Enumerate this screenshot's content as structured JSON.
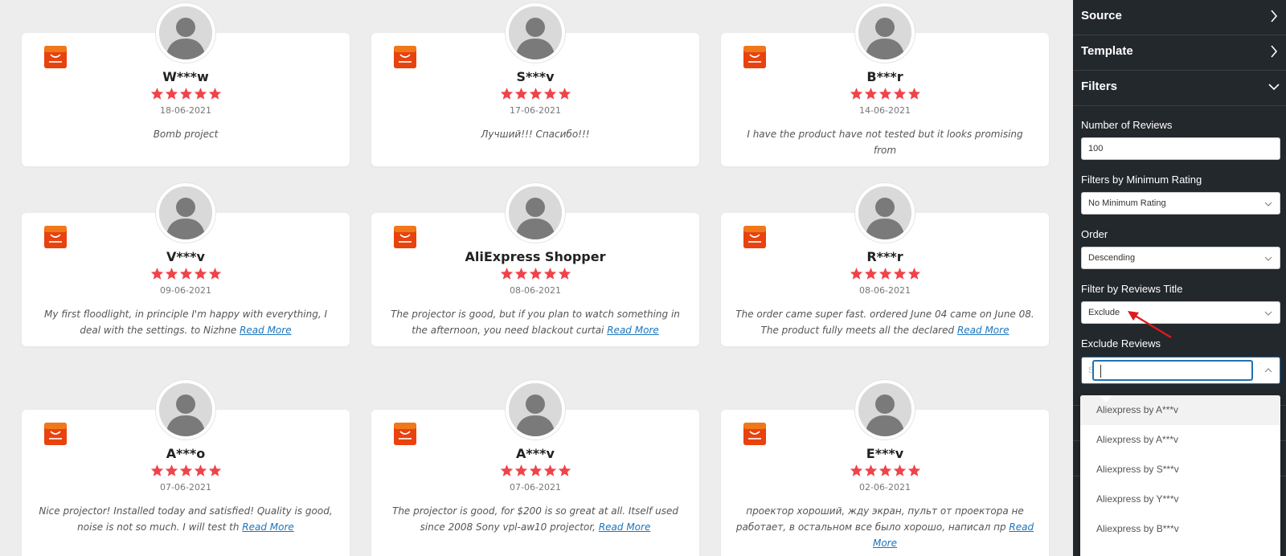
{
  "reviews": [
    {
      "name": "W***w",
      "rating": 5,
      "date": "18-06-2021",
      "text": "Bomb project",
      "read_more": ""
    },
    {
      "name": "S***v",
      "rating": 5,
      "date": "17-06-2021",
      "text": "Лучший!!! Спасибо!!!",
      "read_more": ""
    },
    {
      "name": "B***r",
      "rating": 5,
      "date": "14-06-2021",
      "text": "I have the product have not tested but it looks promising from",
      "read_more": ""
    },
    {
      "name": "V***v",
      "rating": 5,
      "date": "09-06-2021",
      "text": "My first floodlight, in principle I'm happy with everything, I deal with the settings. to Nizhne",
      "read_more": "Read More"
    },
    {
      "name": "AliExpress Shopper",
      "rating": 5,
      "date": "08-06-2021",
      "text": "The projector is good, but if you plan to watch something in the afternoon, you need blackout curtai",
      "read_more": "Read More"
    },
    {
      "name": "R***r",
      "rating": 5,
      "date": "08-06-2021",
      "text": "The order came super fast. ordered June 04 came on June 08. The product fully meets all the declared",
      "read_more": "Read More"
    },
    {
      "name": "A***o",
      "rating": 5,
      "date": "07-06-2021",
      "text": "Nice projector! Installed today and satisfied! Quality is good, noise is not so much. I will test th",
      "read_more": "Read More"
    },
    {
      "name": "A***v",
      "rating": 5,
      "date": "07-06-2021",
      "text": "The projector is good, for $200 is so great at all. Itself used since 2008 Sony vpl-aw10 projector, ",
      "read_more": "Read More"
    },
    {
      "name": "E***v",
      "rating": 5,
      "date": "02-06-2021",
      "text": "проектор хороший, жду экран, пульт от проектора не работает, в остальном все было хорошо, написал пр",
      "read_more": "Read More"
    }
  ],
  "panel": {
    "sections": [
      "Source",
      "Template",
      "Filters"
    ],
    "number_of_reviews": {
      "label": "Number of Reviews",
      "value": "100"
    },
    "min_rating": {
      "label": "Filters by Minimum Rating",
      "value": "No Minimum Rating"
    },
    "order": {
      "label": "Order",
      "value": "Descending"
    },
    "filter_title": {
      "label": "Filter by Reviews Title",
      "value": "Exclude"
    },
    "exclude_reviews": {
      "label": "Exclude Reviews",
      "value": "",
      "prefix": "S"
    },
    "options": [
      "Aliexpress by A***v",
      "Aliexpress by A***v",
      "Aliexpress by S***v",
      "Aliexpress by Y***v",
      "Aliexpress by B***v"
    ]
  },
  "colors": {
    "star": "#f0434a",
    "panel_bg": "#23282d",
    "link": "#1b75bc",
    "arrow": "#e0191e",
    "focus": "#2271b1",
    "aliexpress": "#e8420f"
  },
  "icons": {
    "store": "aliexpress-icon",
    "avatar": "user-avatar-icon",
    "section": "chevron-right-icon",
    "section_open": "chevron-down-icon",
    "select": "chevron-down-icon"
  }
}
